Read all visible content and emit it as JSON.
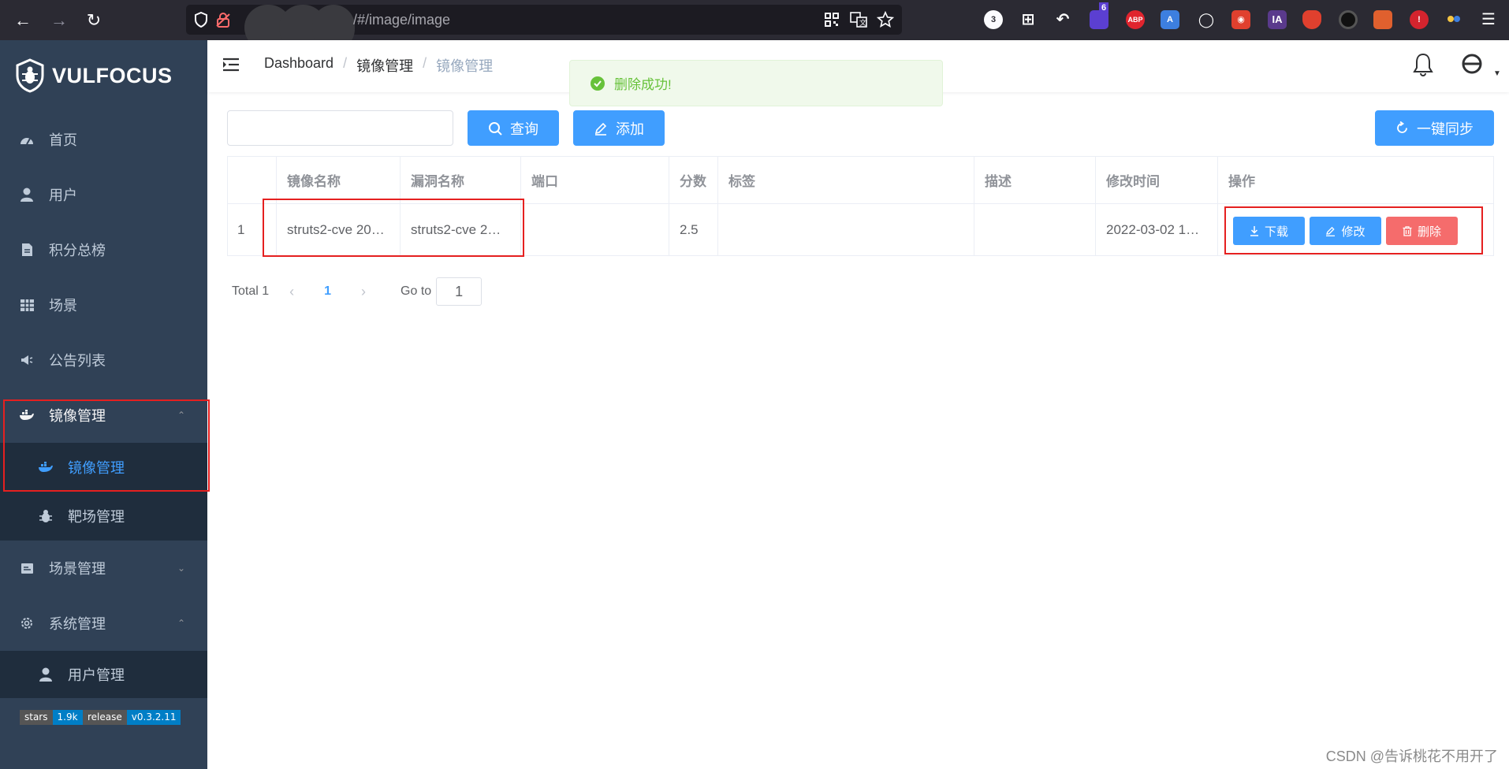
{
  "browser": {
    "url": "/#/image/image",
    "ext_count_badge": "3",
    "ublock_badge": "6",
    "abp_label": "ABP",
    "ia_label": "IA"
  },
  "sidebar": {
    "logo_text": "VULFOCUS",
    "items": [
      {
        "label": "首页",
        "icon": "dashboard-icon"
      },
      {
        "label": "用户",
        "icon": "user-icon"
      },
      {
        "label": "积分总榜",
        "icon": "document-icon"
      },
      {
        "label": "场景",
        "icon": "grid-icon"
      },
      {
        "label": "公告列表",
        "icon": "megaphone-icon"
      },
      {
        "label": "镜像管理",
        "icon": "docker-icon",
        "expanded": true
      },
      {
        "label": "场景管理",
        "icon": "scene-icon",
        "expanded": false
      },
      {
        "label": "系统管理",
        "icon": "gear-icon",
        "expanded": true
      }
    ],
    "image_submenu": [
      {
        "label": "镜像管理",
        "active": true
      },
      {
        "label": "靶场管理",
        "active": false
      }
    ],
    "system_submenu": [
      {
        "label": "用户管理"
      }
    ],
    "badges": {
      "stars_label": "stars",
      "stars_value": "1.9k",
      "release_label": "release",
      "release_value": "v0.3.2.11"
    }
  },
  "header": {
    "breadcrumb": [
      "Dashboard",
      "镜像管理",
      "镜像管理"
    ]
  },
  "toast": {
    "message": "删除成功!",
    "color": "#67c23a"
  },
  "toolbar": {
    "search_value": "",
    "query_label": "查询",
    "add_label": "添加",
    "sync_label": "一键同步"
  },
  "table": {
    "columns": [
      "",
      "镜像名称",
      "漏洞名称",
      "端口",
      "分数",
      "标签",
      "描述",
      "修改时间",
      "操作"
    ],
    "rows": [
      {
        "index": "1",
        "image_name": "struts2-cve 20…",
        "vuln_name": "struts2-cve 2…",
        "port": "",
        "score": "2.5",
        "tags": "",
        "desc": "",
        "modified": "2022-03-02 1…",
        "actions": {
          "download": "下载",
          "edit": "修改",
          "delete": "删除"
        }
      }
    ]
  },
  "pagination": {
    "total_label": "Total 1",
    "current_page": "1",
    "goto_label": "Go to",
    "goto_value": "1"
  },
  "watermark": "CSDN @告诉桃花不用开了",
  "colors": {
    "primary": "#409eff",
    "danger": "#f56c6c",
    "sidebar_bg": "#304156",
    "submenu_bg": "#1f2d3d",
    "highlight_box": "#e52020"
  }
}
